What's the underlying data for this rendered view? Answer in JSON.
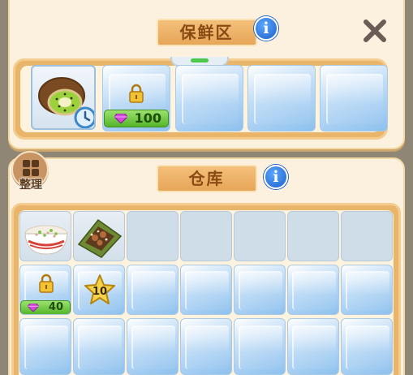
{
  "fresh_zone": {
    "title": "保鲜区",
    "info_icon": "info-icon",
    "close_icon": "close-icon",
    "slots": [
      {
        "item": "kiwi",
        "timer_icon": "clock-icon"
      },
      {
        "locked": true,
        "price": "100",
        "currency_icon": "gem-icon"
      },
      {
        "empty": true
      },
      {
        "empty": true
      },
      {
        "empty": true
      }
    ]
  },
  "warehouse": {
    "title": "仓库",
    "info_icon": "info-icon",
    "sort_button": {
      "label": "整理",
      "icon": "grid-icon"
    },
    "unlock_price": "40",
    "star_level": "10"
  },
  "colors": {
    "panel": "#fbf1de",
    "tab": "#e6a658",
    "tab_text": "#8a4a14",
    "info_blue": "#1d5fc9",
    "price_green": "#55b52a",
    "gem_purple": "#c13ad1"
  }
}
